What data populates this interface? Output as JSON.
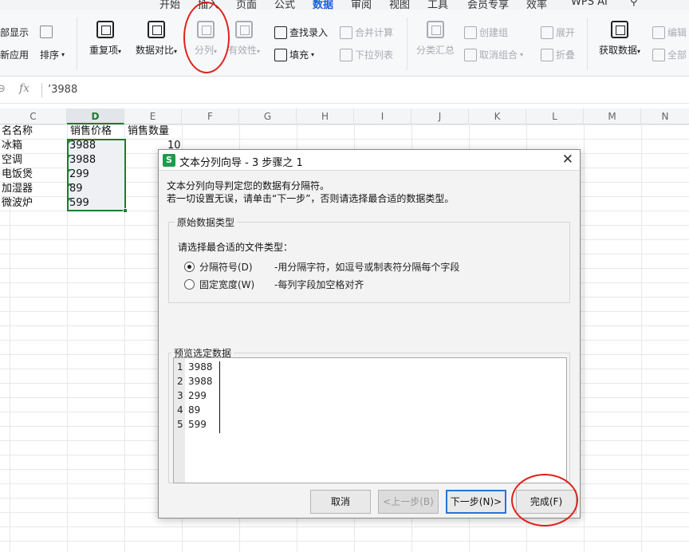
{
  "tabs": [
    "开始",
    "插入",
    "页面",
    "公式",
    "数据",
    "审阅",
    "视图",
    "工具",
    "会员专享",
    "效率",
    "WPS AI"
  ],
  "active_tab": "数据",
  "ribbon": {
    "full_show": "部显示",
    "apply": "新应用",
    "sort": "排序",
    "repeat": "重复项",
    "compare": "数据对比",
    "split": "分列",
    "validity": "有效性",
    "find_entry": "查找录入",
    "fill": "填充",
    "merge_calc": "合并计算",
    "dropdown": "下拉列表",
    "subtotal": "分类汇总",
    "create_group": "创建组",
    "ungroup": "取消组合",
    "expand": "展开",
    "collapse": "折叠",
    "get_data": "获取数据",
    "edit": "编辑",
    "all": "全部"
  },
  "formula_bar": {
    "fx": "fx",
    "value": "’3988"
  },
  "columns": [
    "C",
    "D",
    "E",
    "F",
    "G",
    "H",
    "I",
    "J",
    "K",
    "L",
    "M",
    "N"
  ],
  "selected_column": "D",
  "sheet": {
    "header_c": "名名称",
    "header_d": "销售价格",
    "header_e": "销售数量",
    "e2": "10",
    "rows": [
      {
        "c": "冰箱",
        "d": "3988"
      },
      {
        "c": "空调",
        "d": "3988"
      },
      {
        "c": "电饭煲",
        "d": "299"
      },
      {
        "c": "加湿器",
        "d": "89"
      },
      {
        "c": "微波炉",
        "d": "599"
      }
    ]
  },
  "dialog": {
    "icon": "S",
    "title": "文本分列向导 - 3 步骤之 1",
    "line1": "文本分列向导判定您的数据有分隔符。",
    "line2": "若一切设置无误，请单击“下一步”，否则请选择最合适的数据类型。",
    "group_title": "原始数据类型",
    "prompt": "请选择最合适的文件类型：",
    "opt1_label": "分隔符号(D)",
    "opt1_desc": "-用分隔字符，如逗号或制表符分隔每个字段",
    "opt2_label": "固定宽度(W)",
    "opt2_desc": "-每列字段加空格对齐",
    "preview_title": "预览选定数据",
    "preview": [
      {
        "n": "1",
        "v": "3988"
      },
      {
        "n": "2",
        "v": "3988"
      },
      {
        "n": "3",
        "v": "299"
      },
      {
        "n": "4",
        "v": "89"
      },
      {
        "n": "5",
        "v": "599"
      }
    ],
    "btn_cancel": "取消",
    "btn_prev": "<上一步(B)",
    "btn_next": "下一步(N)>",
    "btn_finish": "完成(F)"
  }
}
